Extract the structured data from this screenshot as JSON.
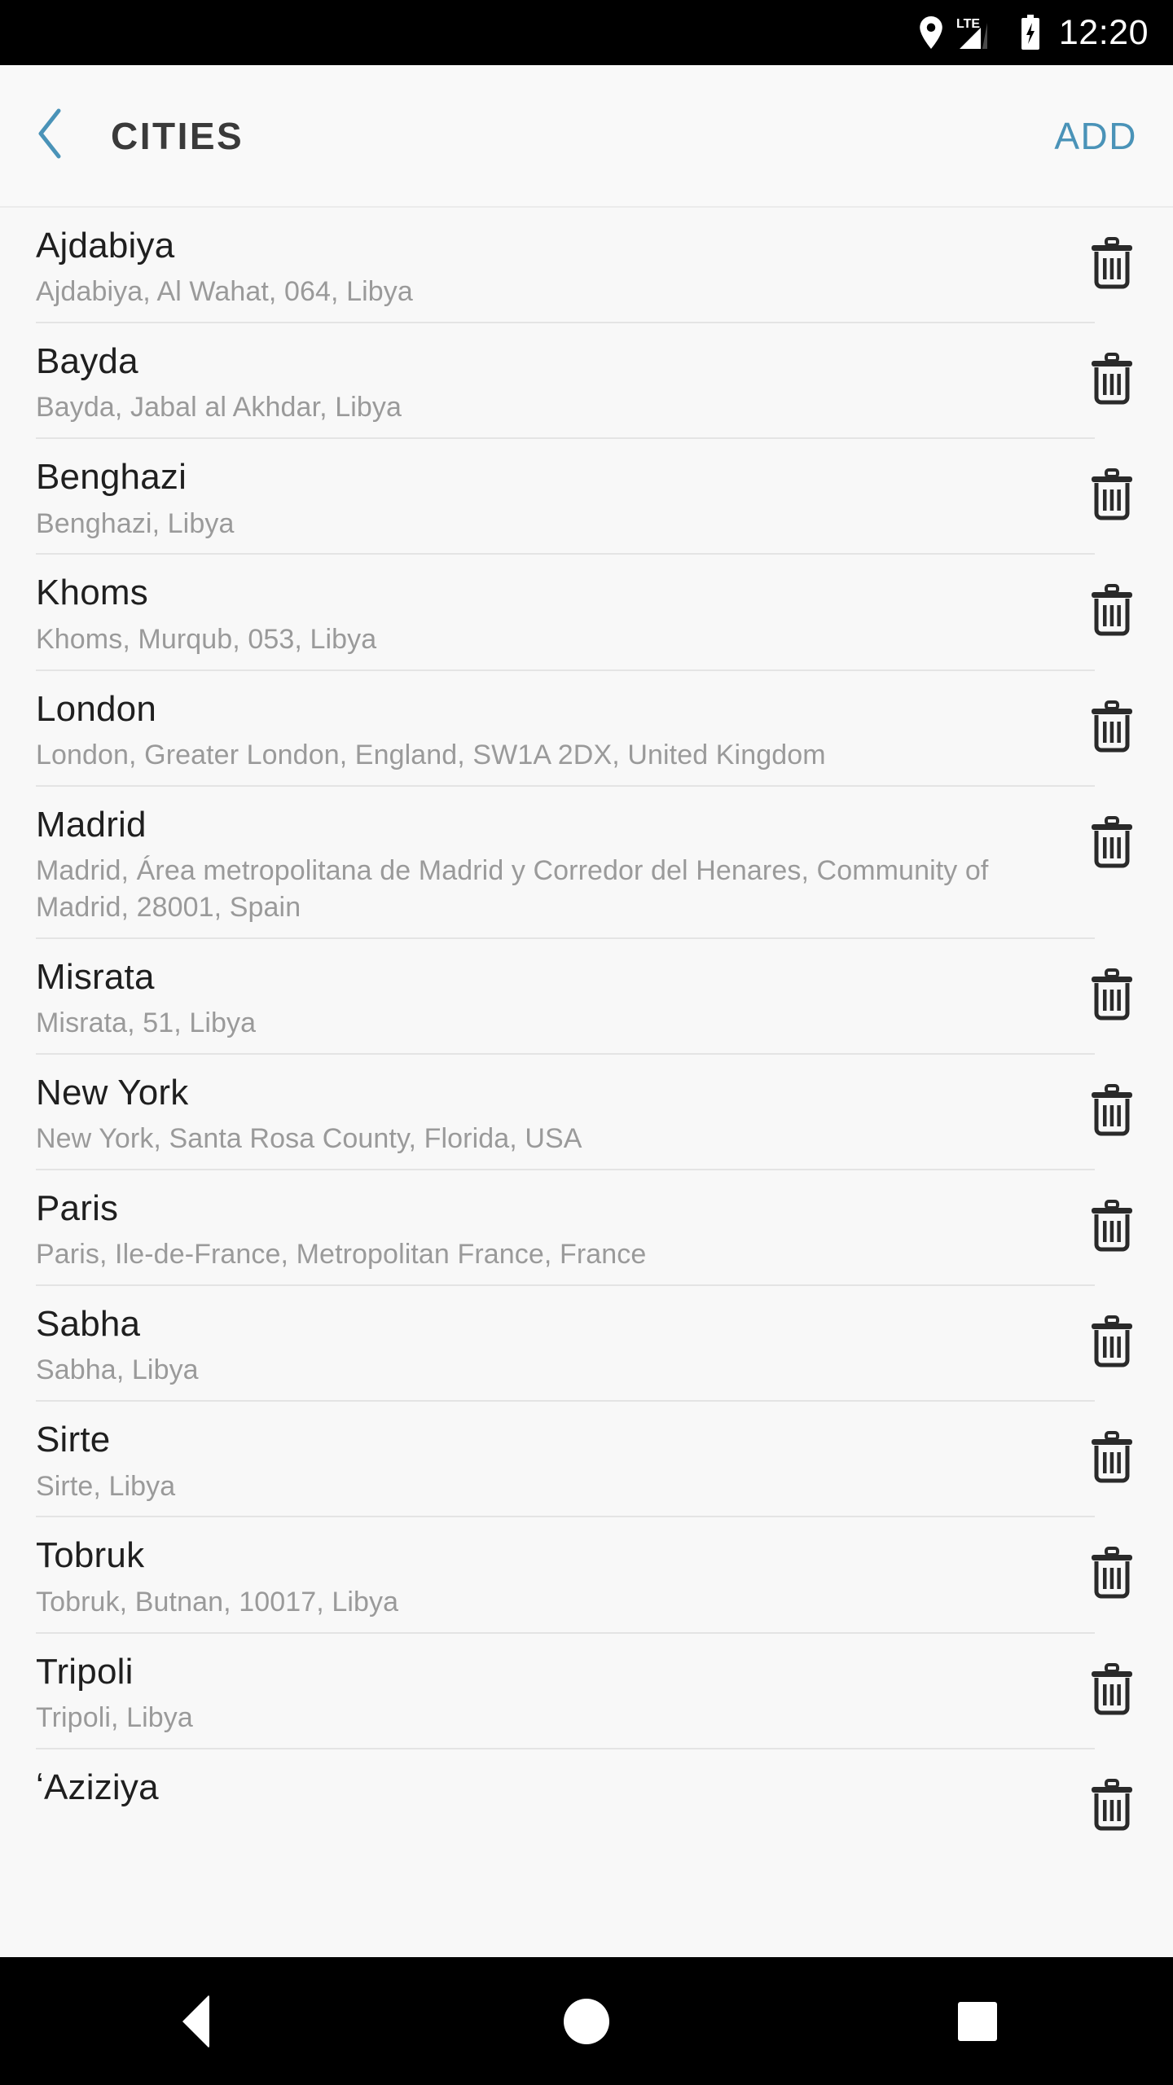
{
  "status_bar": {
    "time": "12:20",
    "network_label": "LTE",
    "icons": [
      "location-pin-icon",
      "lte-signal-icon",
      "battery-charging-icon"
    ]
  },
  "app_bar": {
    "back_icon": "chevron-left-icon",
    "title": "CITIES",
    "add_label": "ADD",
    "accent_color": "#4a93b8",
    "title_color": "#3a3a3a"
  },
  "list": {
    "delete_icon": "trash-icon",
    "items": [
      {
        "name": "Ajdabiya",
        "address": "Ajdabiya, Al Wahat, 064, Libya"
      },
      {
        "name": "Bayda",
        "address": "Bayda, Jabal al Akhdar, Libya"
      },
      {
        "name": "Benghazi",
        "address": "Benghazi, Libya"
      },
      {
        "name": "Khoms",
        "address": "Khoms, Murqub, 053, Libya"
      },
      {
        "name": "London",
        "address": "London, Greater London, England, SW1A 2DX, United Kingdom"
      },
      {
        "name": "Madrid",
        "address": "Madrid, Área metropolitana de Madrid y Corredor del Henares, Community of Madrid, 28001, Spain"
      },
      {
        "name": "Misrata",
        "address": "Misrata, 51, Libya"
      },
      {
        "name": "New York",
        "address": "New York, Santa Rosa County, Florida, USA"
      },
      {
        "name": "Paris",
        "address": "Paris, Ile-de-France, Metropolitan France, France"
      },
      {
        "name": "Sabha",
        "address": "Sabha, Libya"
      },
      {
        "name": "Sirte",
        "address": "Sirte, Libya"
      },
      {
        "name": "Tobruk",
        "address": "Tobruk, Butnan, 10017, Libya"
      },
      {
        "name": "Tripoli",
        "address": "Tripoli, Libya"
      },
      {
        "name": "ʻAziziya",
        "address": ""
      }
    ]
  },
  "nav_bar": {
    "back_icon": "triangle-back-icon",
    "home_icon": "circle-home-icon",
    "recents_icon": "square-recents-icon"
  }
}
